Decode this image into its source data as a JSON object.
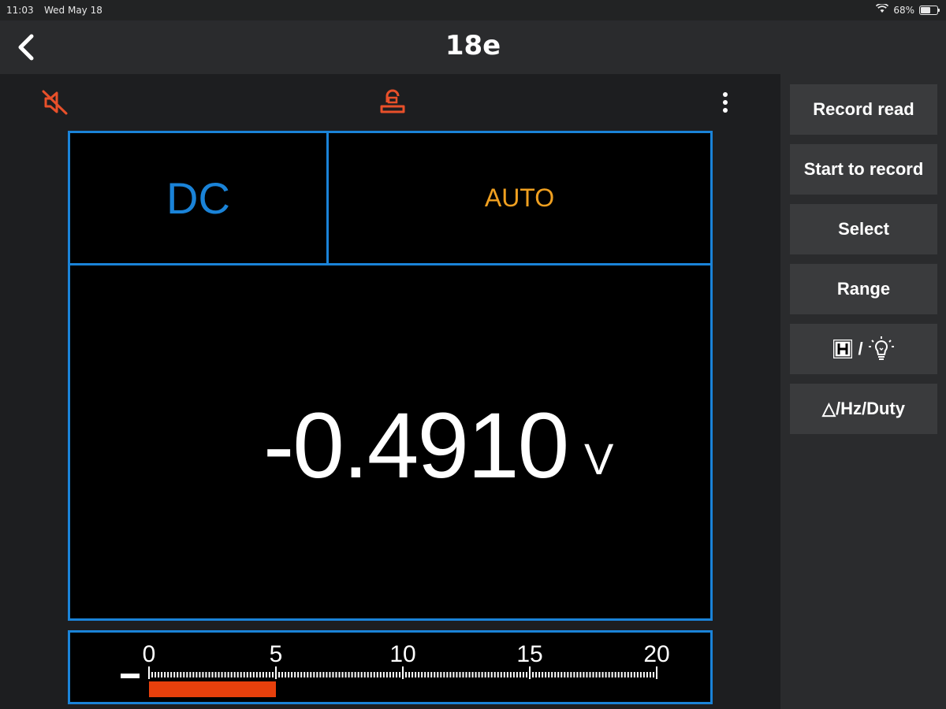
{
  "status_bar": {
    "time": "11:03",
    "date": "Wed May 18",
    "battery_percent": "68%",
    "battery_level": 0.68,
    "wifi_icon": "wifi-icon"
  },
  "nav": {
    "back_icon": "chevron-left-icon",
    "title": "18e"
  },
  "toolbar": {
    "mute_icon": "speaker-muted-icon",
    "hold_icon": "hold-icon",
    "more_icon": "more-vertical-icon"
  },
  "display": {
    "mode": "DC",
    "range": "AUTO",
    "reading": "-0.4910",
    "unit": "V"
  },
  "bargraph": {
    "scale_labels": [
      "0",
      "5",
      "10",
      "15",
      "20"
    ],
    "scale_max": 20,
    "fill_value": 5,
    "negative": true
  },
  "sidebar": {
    "buttons": [
      {
        "label": "Record read"
      },
      {
        "label": "Start to record"
      },
      {
        "label": "Select"
      },
      {
        "label": "Range"
      },
      {
        "label": "/",
        "icons": [
          "hold-h-icon",
          "backlight-bulb-icon"
        ]
      },
      {
        "label": "△/Hz/Duty"
      }
    ]
  },
  "colors": {
    "accent_blue": "#1a83d8",
    "accent_orange": "#f0a020",
    "icon_red": "#e8502a",
    "bar_fill": "#e8400c"
  }
}
